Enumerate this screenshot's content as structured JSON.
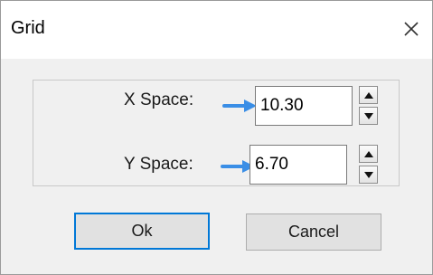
{
  "window": {
    "title": "Grid",
    "close_icon": "close-icon"
  },
  "fields": {
    "x_space": {
      "label": "X Space:",
      "value": "10.30"
    },
    "y_space": {
      "label": "Y Space:",
      "value": "6.70"
    }
  },
  "buttons": {
    "ok_label": "Ok",
    "cancel_label": "Cancel"
  },
  "colors": {
    "annotation_arrow": "#3a8ee6",
    "default_button_border": "#0078d7"
  }
}
